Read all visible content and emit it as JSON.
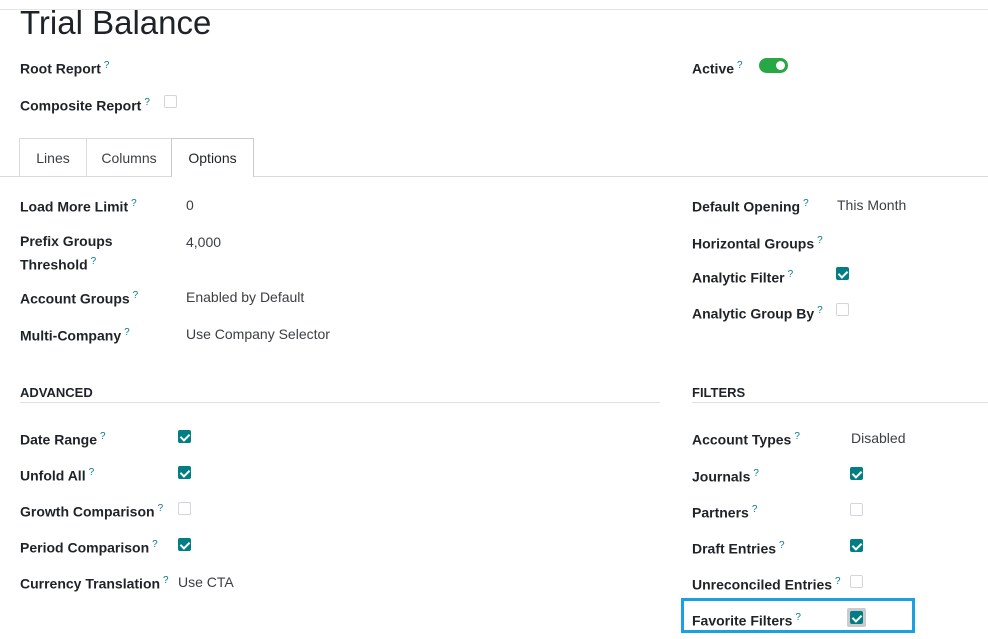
{
  "page": {
    "title": "Trial Balance"
  },
  "header": {
    "root_report_label": "Root Report",
    "composite_report_label": "Composite Report",
    "composite_report_checked": false,
    "active_label": "Active",
    "active_on": true
  },
  "tabs": [
    {
      "label": "Lines",
      "active": false
    },
    {
      "label": "Columns",
      "active": false
    },
    {
      "label": "Options",
      "active": true
    }
  ],
  "options_left": [
    {
      "label": "Load More Limit",
      "value": "0"
    },
    {
      "label_line1": "Prefix Groups",
      "label_line2": "Threshold",
      "value": "4,000"
    },
    {
      "label": "Account Groups",
      "value": "Enabled by Default"
    },
    {
      "label": "Multi-Company",
      "value": "Use Company Selector"
    }
  ],
  "options_right": {
    "default_opening": {
      "label": "Default Opening",
      "value": "This Month"
    },
    "horizontal_groups": {
      "label": "Horizontal Groups",
      "value": ""
    },
    "analytic_filter": {
      "label": "Analytic Filter",
      "checked": true
    },
    "analytic_group_by": {
      "label": "Analytic Group By",
      "checked": false
    }
  },
  "advanced": {
    "heading": "ADVANCED",
    "date_range": {
      "label": "Date Range",
      "checked": true
    },
    "unfold_all": {
      "label": "Unfold All",
      "checked": true
    },
    "growth_comparison": {
      "label": "Growth Comparison",
      "checked": false
    },
    "period_comparison": {
      "label": "Period Comparison",
      "checked": true
    },
    "currency_translation": {
      "label": "Currency Translation",
      "value": "Use CTA"
    }
  },
  "filters": {
    "heading": "FILTERS",
    "account_types": {
      "label": "Account Types",
      "value": "Disabled"
    },
    "journals": {
      "label": "Journals",
      "checked": true
    },
    "partners": {
      "label": "Partners",
      "checked": false
    },
    "draft_entries": {
      "label": "Draft Entries",
      "checked": true
    },
    "unreconciled_entries": {
      "label": "Unreconciled Entries",
      "checked": false
    },
    "favorite_filters": {
      "label": "Favorite Filters",
      "checked": true
    }
  },
  "help_marker": "?",
  "colors": {
    "accent": "#017e84",
    "toggle_on": "#28a745",
    "highlight": "#1ba1e2"
  }
}
